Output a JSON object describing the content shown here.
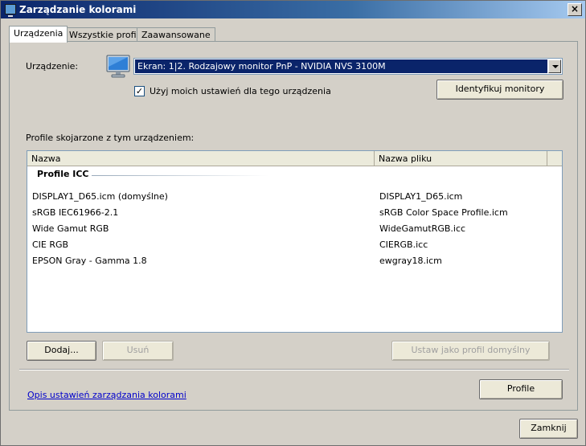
{
  "window": {
    "title": "Zarządzanie kolorami",
    "close_glyph": "×"
  },
  "tabs": [
    {
      "label": "Urządzenia",
      "active": true
    },
    {
      "label": "Wszystkie profile",
      "active": false
    },
    {
      "label": "Zaawansowane",
      "active": false
    }
  ],
  "device": {
    "label": "Urządzenie:",
    "icon": "monitor-icon",
    "selected": "Ekran: 1|2. Rodzajowy monitor PnP - NVIDIA NVS 3100M",
    "use_my_settings_label": "Użyj moich ustawień dla tego urządzenia",
    "use_my_settings_checked": true,
    "check_glyph": "✓",
    "identify_button": "Identyfikuj monitory"
  },
  "profiles": {
    "section_label": "Profile skojarzone z tym urządzeniem:",
    "columns": [
      "Nazwa",
      "Nazwa pliku"
    ],
    "group": "Profile ICC",
    "rows": [
      {
        "name": "DISPLAY1_D65.icm (domyślne)",
        "file": "DISPLAY1_D65.icm"
      },
      {
        "name": "sRGB IEC61966-2.1",
        "file": "sRGB Color Space Profile.icm"
      },
      {
        "name": "Wide Gamut RGB",
        "file": "WideGamutRGB.icc"
      },
      {
        "name": "CIE RGB",
        "file": "CIERGB.icc"
      },
      {
        "name": "EPSON  Gray - Gamma 1.8",
        "file": "ewgray18.icm"
      }
    ]
  },
  "buttons": {
    "add": "Dodaj...",
    "remove": "Usuń",
    "set_default": "Ustaw jako profil domyślny",
    "profiles": "Profile",
    "close": "Zamknij"
  },
  "help_link": "Opis ustawień zarządzania kolorami",
  "colors": {
    "selection": "#0a246a",
    "link": "#0000cc",
    "titlebar": "#0a246a"
  }
}
